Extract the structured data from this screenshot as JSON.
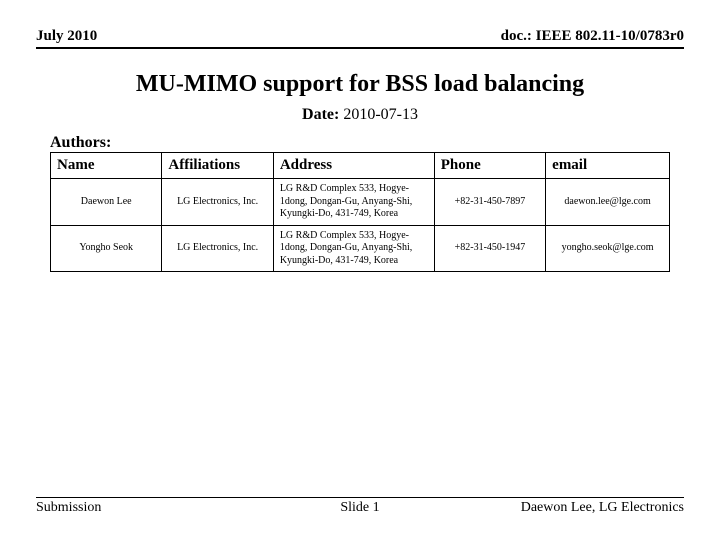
{
  "header": {
    "left": "July 2010",
    "right": "doc.: IEEE 802.11-10/0783r0"
  },
  "title": "MU-MIMO support for BSS load balancing",
  "date": {
    "label": "Date:",
    "value": "2010-07-13"
  },
  "authors_label": "Authors:",
  "table": {
    "headers": [
      "Name",
      "Affiliations",
      "Address",
      "Phone",
      "email"
    ],
    "rows": [
      {
        "name": "Daewon Lee",
        "affiliation": "LG Electronics, Inc.",
        "address": "LG R&D Complex 533, Hogye-1dong, Dongan-Gu, Anyang-Shi, Kyungki-Do, 431-749, Korea",
        "phone": "+82-31-450-7897",
        "email": "daewon.lee@lge.com"
      },
      {
        "name": "Yongho Seok",
        "affiliation": "LG Electronics, Inc.",
        "address": "LG R&D Complex 533, Hogye-1dong, Dongan-Gu, Anyang-Shi, Kyungki-Do, 431-749, Korea",
        "phone": "+82-31-450-1947",
        "email": "yongho.seok@lge.com"
      }
    ]
  },
  "footer": {
    "left": "Submission",
    "center": "Slide 1",
    "right": "Daewon Lee, LG Electronics"
  }
}
